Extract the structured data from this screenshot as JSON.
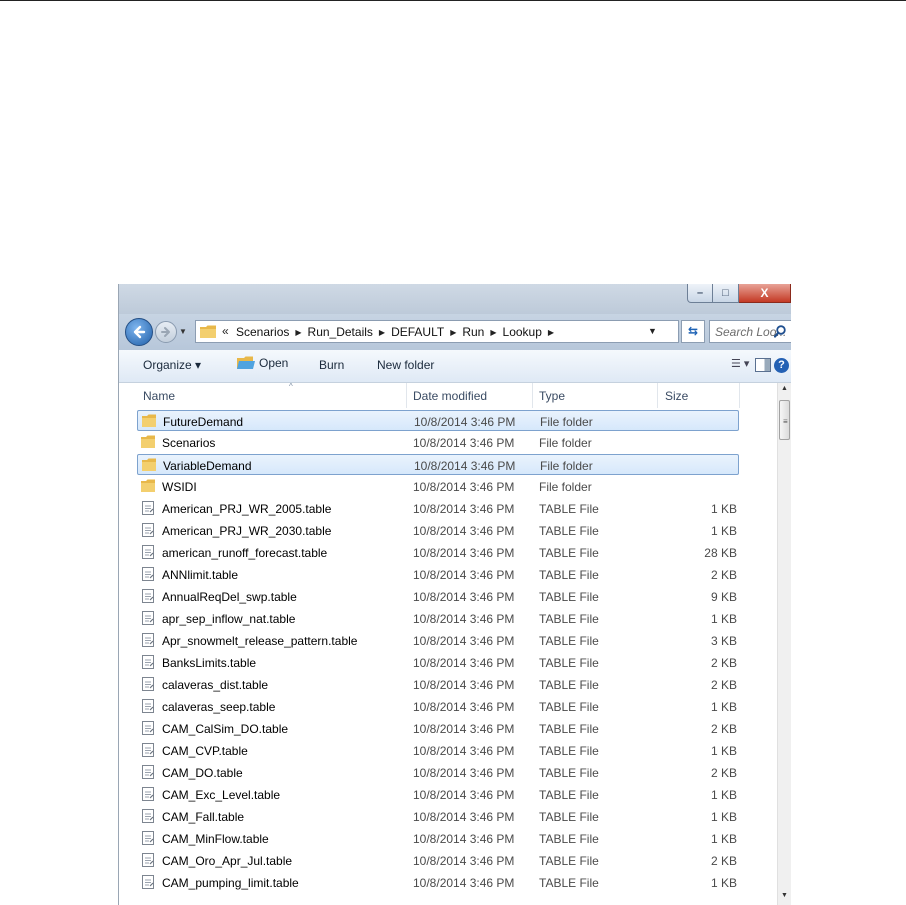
{
  "window": {
    "controls": {
      "minimize": "–",
      "maximize": "□",
      "close": "X"
    }
  },
  "navbar": {
    "overflow_chevron": "«",
    "breadcrumbs": [
      "Scenarios",
      "Run_Details",
      "DEFAULT",
      "Run",
      "Lookup"
    ],
    "search_placeholder": "Search Loo..."
  },
  "toolbar": {
    "organize_label": "Organize ▾",
    "open_label": "Open",
    "burn_label": "Burn",
    "new_folder_label": "New folder",
    "help_label": "?"
  },
  "columns": {
    "name": "Name",
    "date": "Date modified",
    "type": "Type",
    "size": "Size"
  },
  "files": [
    {
      "name": "FutureDemand",
      "date": "10/8/2014 3:46 PM",
      "type": "File folder",
      "size": "",
      "kind": "folder",
      "selected": true
    },
    {
      "name": "Scenarios",
      "date": "10/8/2014 3:46 PM",
      "type": "File folder",
      "size": "",
      "kind": "folder",
      "selected": false
    },
    {
      "name": "VariableDemand",
      "date": "10/8/2014 3:46 PM",
      "type": "File folder",
      "size": "",
      "kind": "folder",
      "selected": true
    },
    {
      "name": "WSIDI",
      "date": "10/8/2014 3:46 PM",
      "type": "File folder",
      "size": "",
      "kind": "folder",
      "selected": false
    },
    {
      "name": "American_PRJ_WR_2005.table",
      "date": "10/8/2014 3:46 PM",
      "type": "TABLE File",
      "size": "1 KB",
      "kind": "file",
      "selected": false
    },
    {
      "name": "American_PRJ_WR_2030.table",
      "date": "10/8/2014 3:46 PM",
      "type": "TABLE File",
      "size": "1 KB",
      "kind": "file",
      "selected": false
    },
    {
      "name": "american_runoff_forecast.table",
      "date": "10/8/2014 3:46 PM",
      "type": "TABLE File",
      "size": "28 KB",
      "kind": "file",
      "selected": false
    },
    {
      "name": "ANNlimit.table",
      "date": "10/8/2014 3:46 PM",
      "type": "TABLE File",
      "size": "2 KB",
      "kind": "file",
      "selected": false
    },
    {
      "name": "AnnualReqDel_swp.table",
      "date": "10/8/2014 3:46 PM",
      "type": "TABLE File",
      "size": "9 KB",
      "kind": "file",
      "selected": false
    },
    {
      "name": "apr_sep_inflow_nat.table",
      "date": "10/8/2014 3:46 PM",
      "type": "TABLE File",
      "size": "1 KB",
      "kind": "file",
      "selected": false
    },
    {
      "name": "Apr_snowmelt_release_pattern.table",
      "date": "10/8/2014 3:46 PM",
      "type": "TABLE File",
      "size": "3 KB",
      "kind": "file",
      "selected": false
    },
    {
      "name": "BanksLimits.table",
      "date": "10/8/2014 3:46 PM",
      "type": "TABLE File",
      "size": "2 KB",
      "kind": "file",
      "selected": false
    },
    {
      "name": "calaveras_dist.table",
      "date": "10/8/2014 3:46 PM",
      "type": "TABLE File",
      "size": "2 KB",
      "kind": "file",
      "selected": false
    },
    {
      "name": "calaveras_seep.table",
      "date": "10/8/2014 3:46 PM",
      "type": "TABLE File",
      "size": "1 KB",
      "kind": "file",
      "selected": false
    },
    {
      "name": "CAM_CalSim_DO.table",
      "date": "10/8/2014 3:46 PM",
      "type": "TABLE File",
      "size": "2 KB",
      "kind": "file",
      "selected": false
    },
    {
      "name": "CAM_CVP.table",
      "date": "10/8/2014 3:46 PM",
      "type": "TABLE File",
      "size": "1 KB",
      "kind": "file",
      "selected": false
    },
    {
      "name": "CAM_DO.table",
      "date": "10/8/2014 3:46 PM",
      "type": "TABLE File",
      "size": "2 KB",
      "kind": "file",
      "selected": false
    },
    {
      "name": "CAM_Exc_Level.table",
      "date": "10/8/2014 3:46 PM",
      "type": "TABLE File",
      "size": "1 KB",
      "kind": "file",
      "selected": false
    },
    {
      "name": "CAM_Fall.table",
      "date": "10/8/2014 3:46 PM",
      "type": "TABLE File",
      "size": "1 KB",
      "kind": "file",
      "selected": false
    },
    {
      "name": "CAM_MinFlow.table",
      "date": "10/8/2014 3:46 PM",
      "type": "TABLE File",
      "size": "1 KB",
      "kind": "file",
      "selected": false
    },
    {
      "name": "CAM_Oro_Apr_Jul.table",
      "date": "10/8/2014 3:46 PM",
      "type": "TABLE File",
      "size": "2 KB",
      "kind": "file",
      "selected": false
    },
    {
      "name": "CAM_pumping_limit.table",
      "date": "10/8/2014 3:46 PM",
      "type": "TABLE File",
      "size": "1 KB",
      "kind": "file",
      "selected": false
    }
  ],
  "colors": {
    "folder": "#e8b84a",
    "selection": "#d6e8fb",
    "selection_border": "#7da2ce",
    "close_button": "#c43a25"
  }
}
